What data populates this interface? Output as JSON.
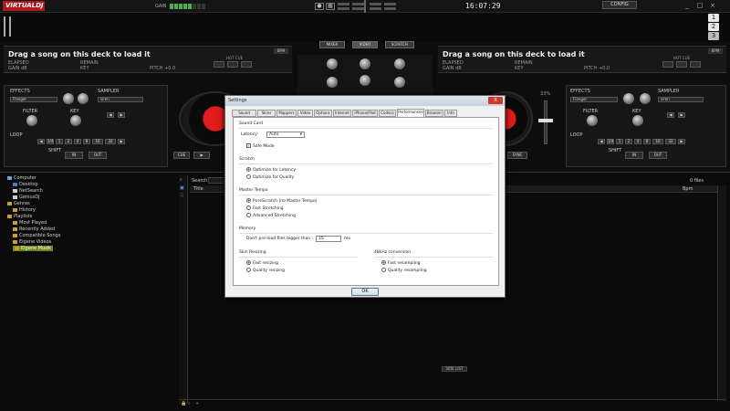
{
  "app": {
    "logo": "VIRTUALDJ",
    "clock": "16:07:29",
    "config": "CONFIG",
    "gain_label": "GAIN",
    "win_buttons": [
      "_",
      "□",
      "×"
    ],
    "deck_numbers": [
      "1",
      "2",
      "3"
    ]
  },
  "deck_left": {
    "message": "Drag a song on this deck to load it",
    "elapsed": "ELAPSED",
    "remain": "REMAIN",
    "gain": "GAIN dB",
    "key": "KEY",
    "pitch": "PITCH +0.0",
    "bpm": "BPM",
    "hot_cue": "HOT CUE",
    "effects": "EFFECTS",
    "effect_value": "Flanger",
    "sampler": "SAMPLER",
    "sampler_value": "siren",
    "filter": "FILTER",
    "key_label": "KEY",
    "loop": "LOOP",
    "shift": "SHIFT",
    "in": "IN",
    "out": "OUT",
    "cue": "CUE",
    "loop_values": [
      "1/4",
      "1",
      "2",
      "4",
      "8",
      "16",
      "32"
    ]
  },
  "deck_right": {
    "message": "Drag a song on this deck to load it",
    "elapsed": "ELAPSED",
    "remain": "REMAIN",
    "gain": "GAIN dB",
    "key": "KEY",
    "pitch": "PITCH +0.0",
    "bpm": "BPM",
    "hot_cue": "HOT CUE",
    "effects": "EFFECTS",
    "effect_value": "Flanger",
    "sampler": "SAMPLER",
    "sampler_value": "siren",
    "filter": "FILTER",
    "key_label": "KEY",
    "loop": "LOOP",
    "shift": "SHIFT",
    "in": "IN",
    "out": "OUT",
    "sync": "SYNC",
    "pitch_pct": "33%",
    "loop_values": [
      "1/4",
      "1",
      "2",
      "4",
      "8",
      "16",
      "32"
    ]
  },
  "mixer": {
    "tabs": [
      "MIXER",
      "VIDEO",
      "SCRATCH"
    ],
    "active_tab": "VIDEO"
  },
  "browser": {
    "search_label": "Search",
    "search_value": "",
    "file_count": "0 files",
    "columns": [
      "Title",
      "Bpm"
    ],
    "side_list": "SIDE LIST",
    "tree": [
      {
        "label": "Computer",
        "indent": 0,
        "icon": "computer-icon",
        "color": "#6aa0e8"
      },
      {
        "label": "Desktop",
        "indent": 1,
        "icon": "desktop-icon",
        "color": "#4a78c8"
      },
      {
        "label": "NetSearch",
        "indent": 1,
        "icon": "search-icon",
        "color": "#cfcfcf"
      },
      {
        "label": "GeniusDJ",
        "indent": 1,
        "icon": "genius-icon",
        "color": "#cfcfcf"
      },
      {
        "label": "Genres",
        "indent": 0,
        "icon": "folder-icon",
        "color": "#c8a030"
      },
      {
        "label": "History",
        "indent": 1,
        "icon": "folder-icon",
        "color": "#c8a030"
      },
      {
        "label": "Playlists",
        "indent": 0,
        "icon": "folder-icon",
        "color": "#c8a030"
      },
      {
        "label": "Most Played",
        "indent": 1,
        "icon": "playlist-icon",
        "color": "#c8a030"
      },
      {
        "label": "Recently Added",
        "indent": 1,
        "icon": "playlist-icon",
        "color": "#c8a030"
      },
      {
        "label": "Compatible Songs",
        "indent": 1,
        "icon": "playlist-icon",
        "color": "#c8a030"
      },
      {
        "label": "Eigene Videos",
        "indent": 1,
        "icon": "folder-icon",
        "color": "#c8a030"
      },
      {
        "label": "Eigene Musik",
        "indent": 1,
        "icon": "folder-icon",
        "color": "#c8a030",
        "selected": true
      }
    ]
  },
  "settings": {
    "title": "Settings",
    "close": "X",
    "tabs": [
      "Sound Setup",
      "Skins",
      "Mappers",
      "Video",
      "Options",
      "Internet",
      "iPhone/iPad",
      "Codecs",
      "Performances",
      "Browser",
      "Info"
    ],
    "active_tab": "Performances",
    "sound_card": {
      "title": "Sound Card",
      "latency_label": "Latency:",
      "latency_value": "Auto",
      "safe_mode": "Safe Mode",
      "safe_mode_checked": true
    },
    "scratch": {
      "title": "Scratch",
      "options": [
        "Optimize for Latency",
        "Optimize for Quality"
      ],
      "selected": 0
    },
    "master_tempo": {
      "title": "Master Tempo",
      "options": [
        "PureScratch (no Master Tempo)",
        "Fast Stretching",
        "Advanced Stretching"
      ],
      "selected": 0
    },
    "memory": {
      "title": "Memory",
      "label": "Don't pre-load files bigger than :",
      "value": "15",
      "unit": "mo"
    },
    "skin_resizing": {
      "title": "Skin Resizing",
      "options": [
        "Fast resizing",
        "Quality resizing"
      ],
      "selected": 0
    },
    "khz": {
      "title": "48kHz conversion",
      "options": [
        "Fast resampling",
        "Quality resampling"
      ],
      "selected": 0
    },
    "ok": "OK"
  },
  "colors": {
    "accent_red": "#e01c1c",
    "selected_green": "#6e8a1e",
    "gain_green": "#4db04d"
  }
}
